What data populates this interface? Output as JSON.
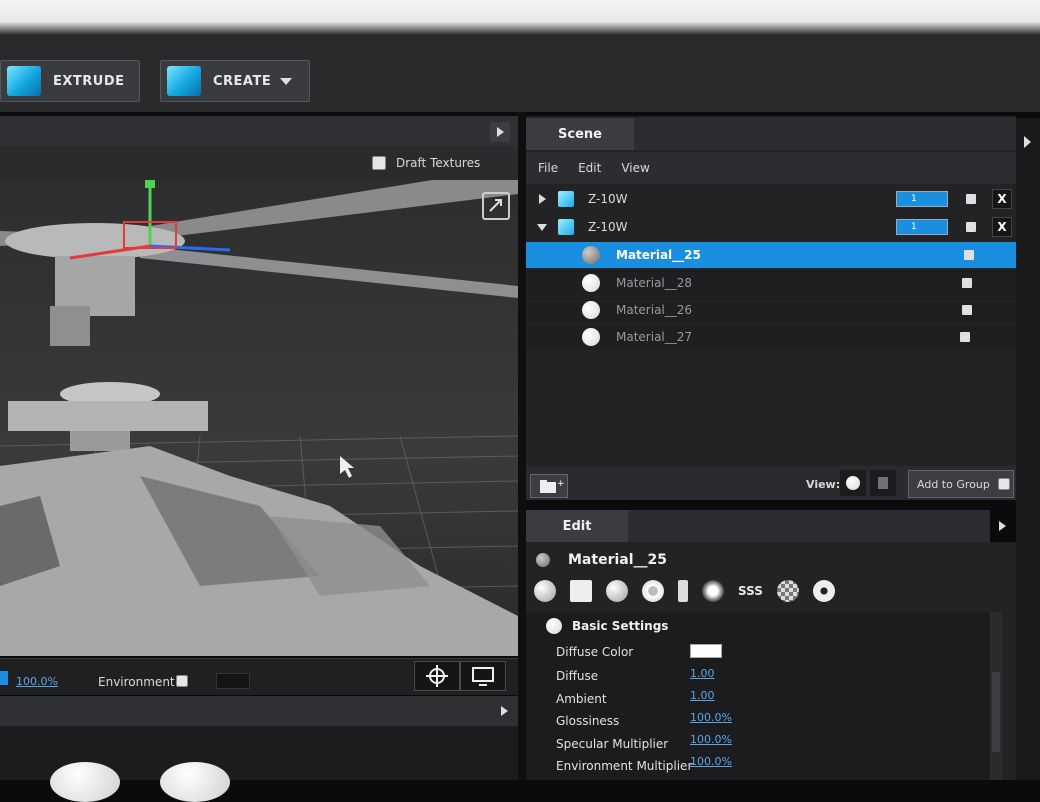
{
  "toolbar": {
    "extrude_label": "EXTRUDE",
    "create_label": "CREATE"
  },
  "viewport": {
    "draft_textures_label": "Draft Textures",
    "zoom_value": "100.0%",
    "environment_label": "Environment"
  },
  "scene": {
    "tab_label": "Scene",
    "menu": [
      "File",
      "Edit",
      "View"
    ],
    "objects": [
      {
        "name": "Z-10W",
        "count": "1",
        "expanded": false
      },
      {
        "name": "Z-10W",
        "count": "1",
        "expanded": true
      }
    ],
    "materials": [
      {
        "name": "Material__25",
        "selected": true
      },
      {
        "name": "Material__28",
        "selected": false
      },
      {
        "name": "Material__26",
        "selected": false
      },
      {
        "name": "Material__27",
        "selected": false
      }
    ],
    "view_label": "View:",
    "add_to_group_label": "Add to Group"
  },
  "edit": {
    "tab_label": "Edit",
    "material_name": "Material__25",
    "sss_label": "SSS",
    "section_label": "Basic Settings",
    "properties": [
      {
        "label": "Diffuse Color",
        "value": ""
      },
      {
        "label": "Diffuse",
        "value": "1.00"
      },
      {
        "label": "Ambient",
        "value": "1.00"
      },
      {
        "label": "Glossiness",
        "value": "100.0%"
      },
      {
        "label": "Specular Multiplier",
        "value": "100.0%"
      },
      {
        "label": "Environment Multiplier",
        "value": "100.0%"
      }
    ]
  },
  "colors": {
    "selection": "#1a8fe0",
    "accent_icon": "#12a6e0",
    "link": "#5aa7e8"
  }
}
